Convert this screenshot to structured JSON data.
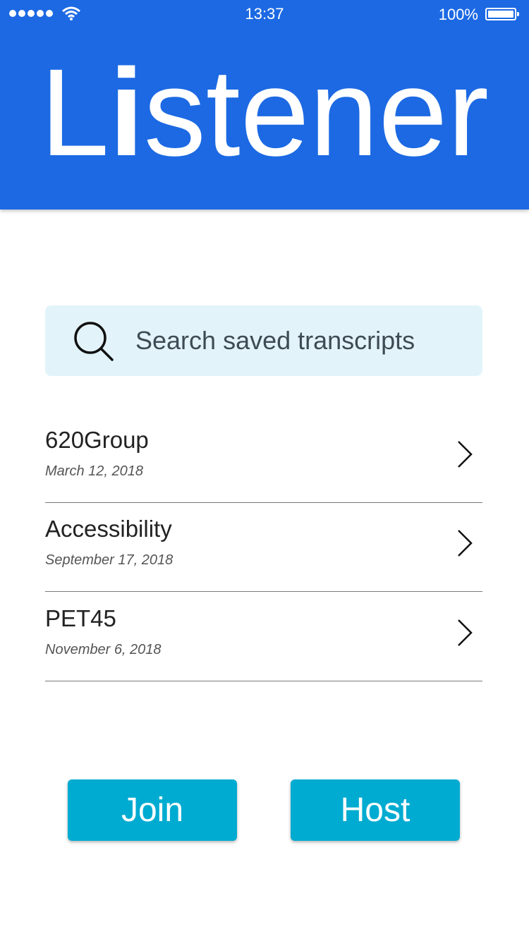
{
  "status_bar": {
    "time": "13:37",
    "battery": "100%"
  },
  "app": {
    "logo_first": "L",
    "logo_i": "i",
    "logo_rest": "stener"
  },
  "search": {
    "placeholder": "Search saved transcripts"
  },
  "transcripts": [
    {
      "title": "620Group",
      "date": "March 12, 2018"
    },
    {
      "title": "Accessibility",
      "date": "September 17, 2018"
    },
    {
      "title": "PET45",
      "date": "November 6, 2018"
    }
  ],
  "buttons": {
    "join": "Join",
    "host": "Host"
  },
  "colors": {
    "header": "#1c69e3",
    "search_bg": "#e2f4f9",
    "button": "#00abd1"
  }
}
